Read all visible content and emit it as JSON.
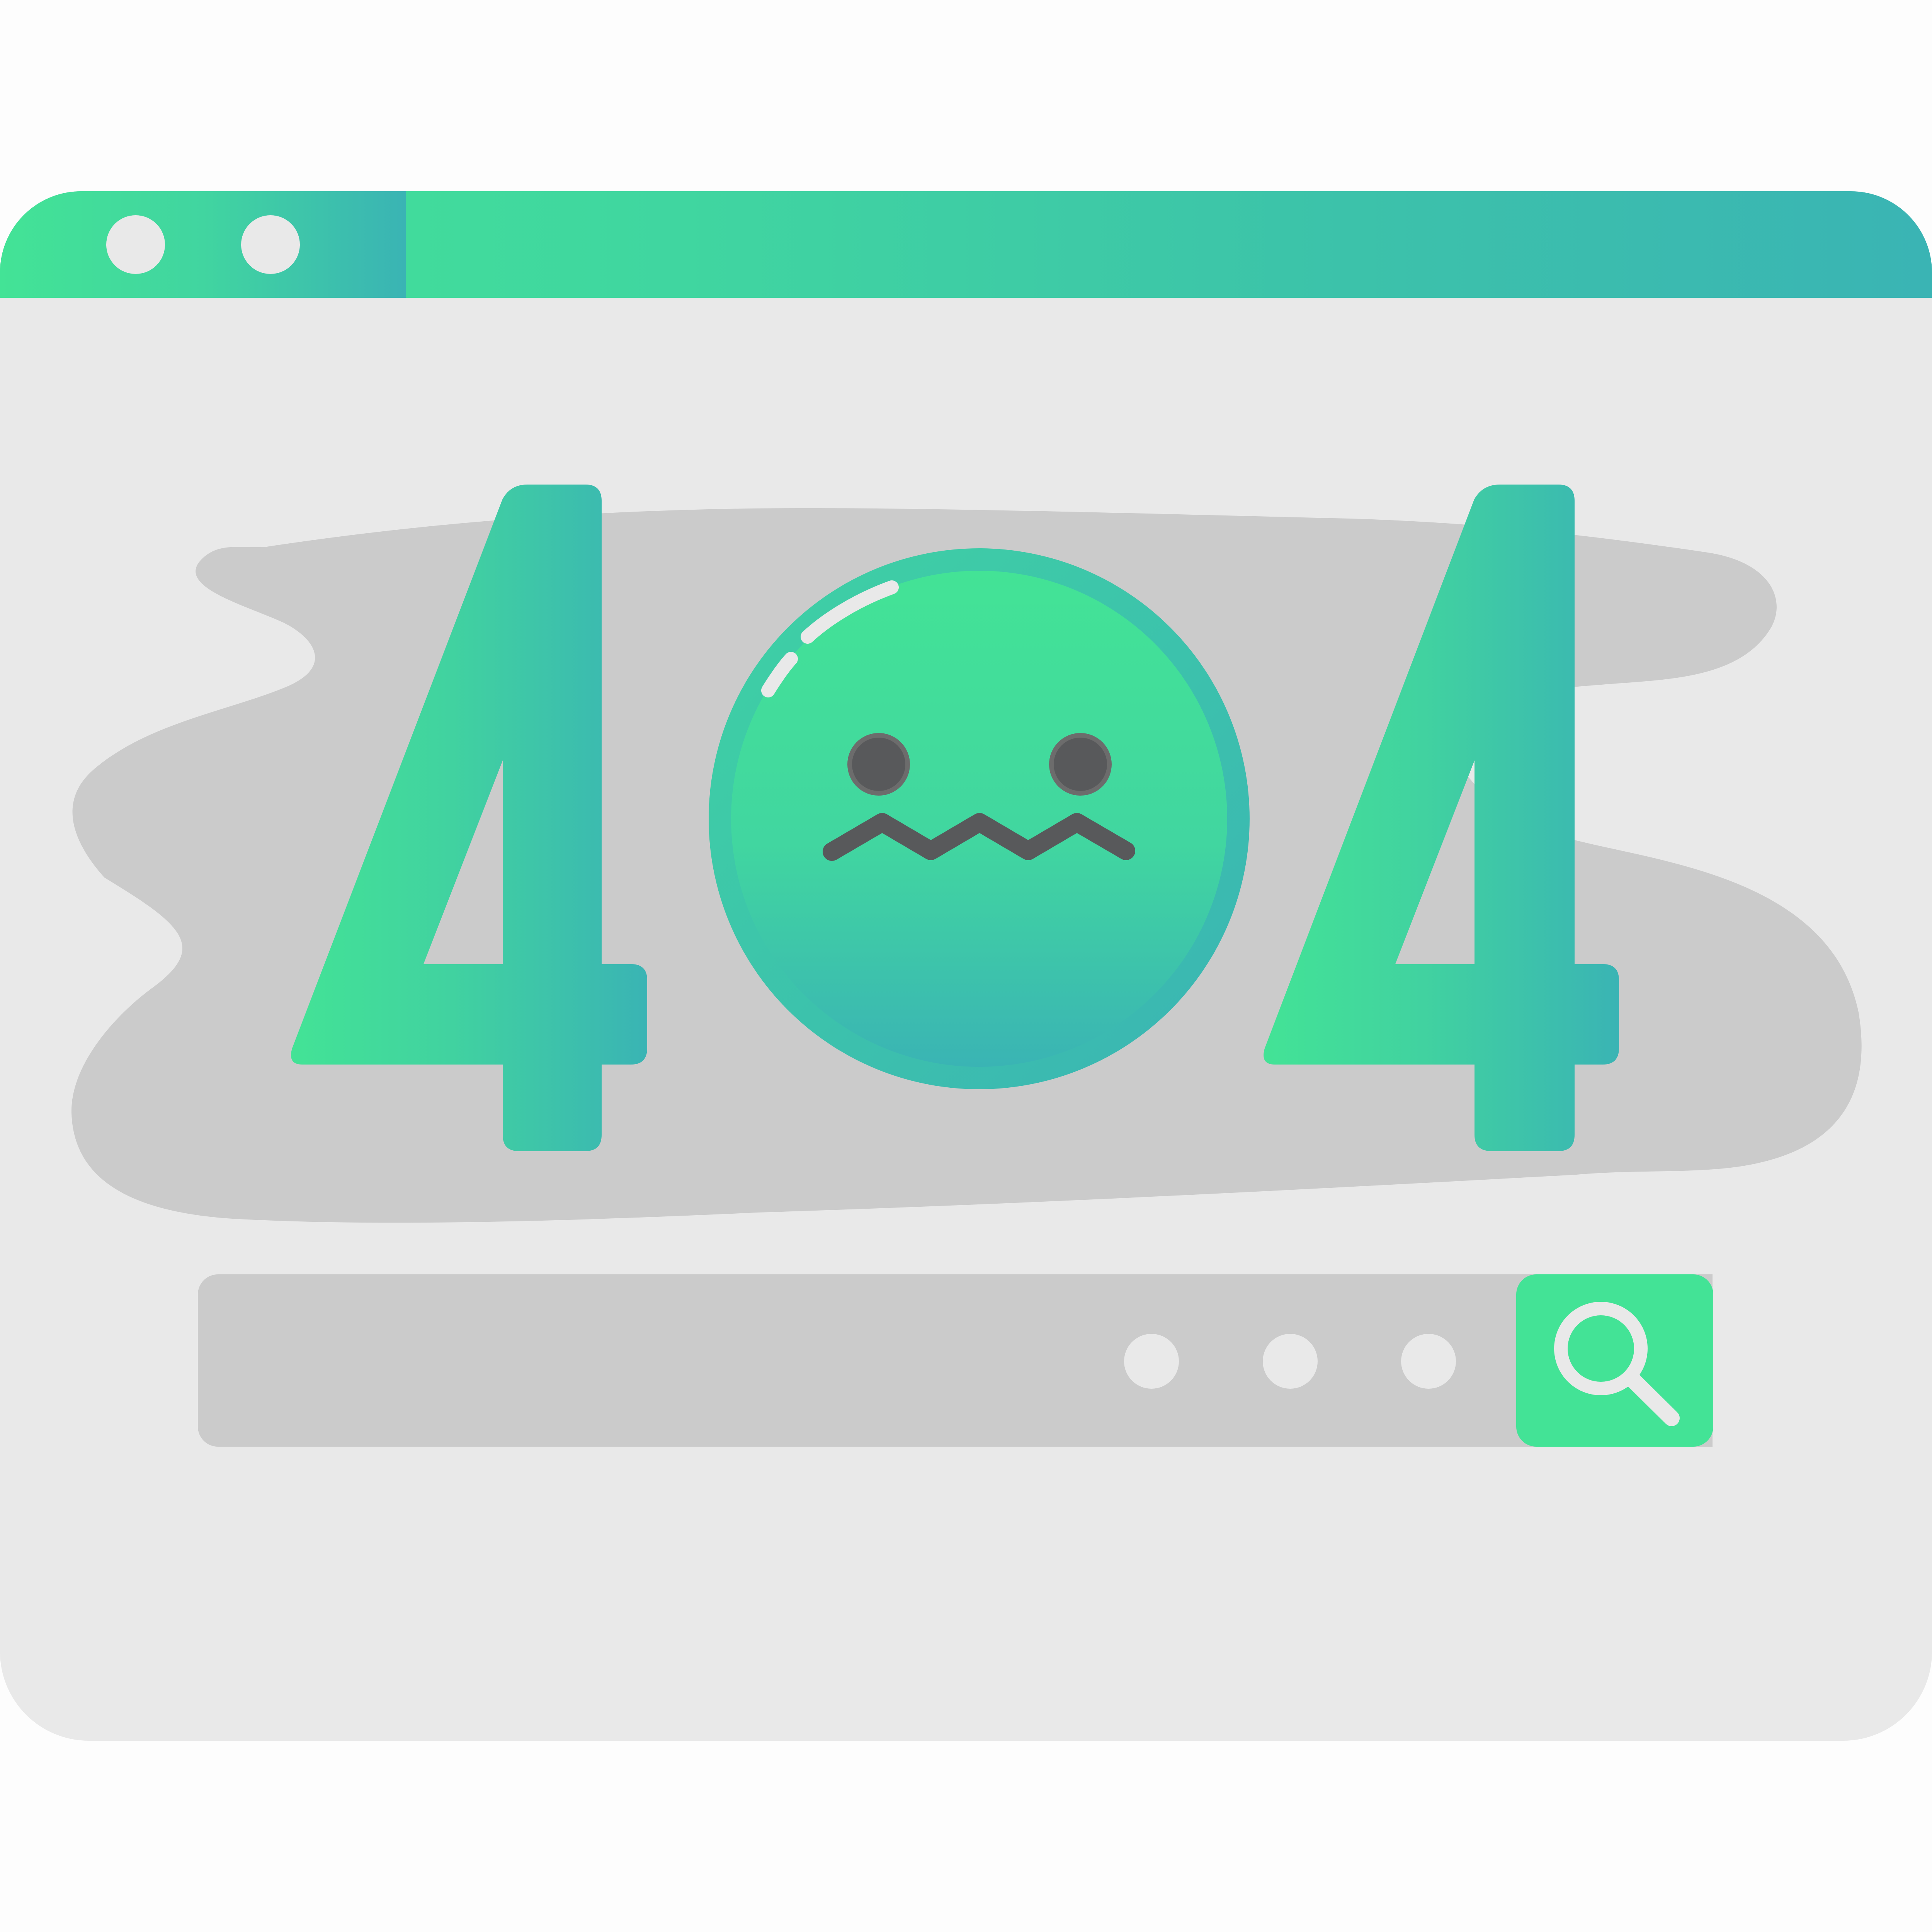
{
  "error_page": {
    "code": "404",
    "digits": [
      "4",
      "0",
      "4"
    ]
  },
  "colors": {
    "brand_green": "#43e396",
    "brand_teal": "#3ab4b4",
    "window_background": "#e9e9e9",
    "splash_gray": "#cbcbcb",
    "face_feature_gray": "#58595b"
  },
  "window": {
    "controls": [
      {
        "name": "window-control-dot-1",
        "icon": "circle-icon"
      },
      {
        "name": "window-control-dot-2",
        "icon": "circle-icon"
      }
    ]
  },
  "search": {
    "value": "",
    "placeholder_dots": 3,
    "button_icon": "magnifying-glass-icon"
  },
  "illustration": {
    "face_icon": "zigzag-mouth-face-icon",
    "background_shape": "splash-blob"
  }
}
